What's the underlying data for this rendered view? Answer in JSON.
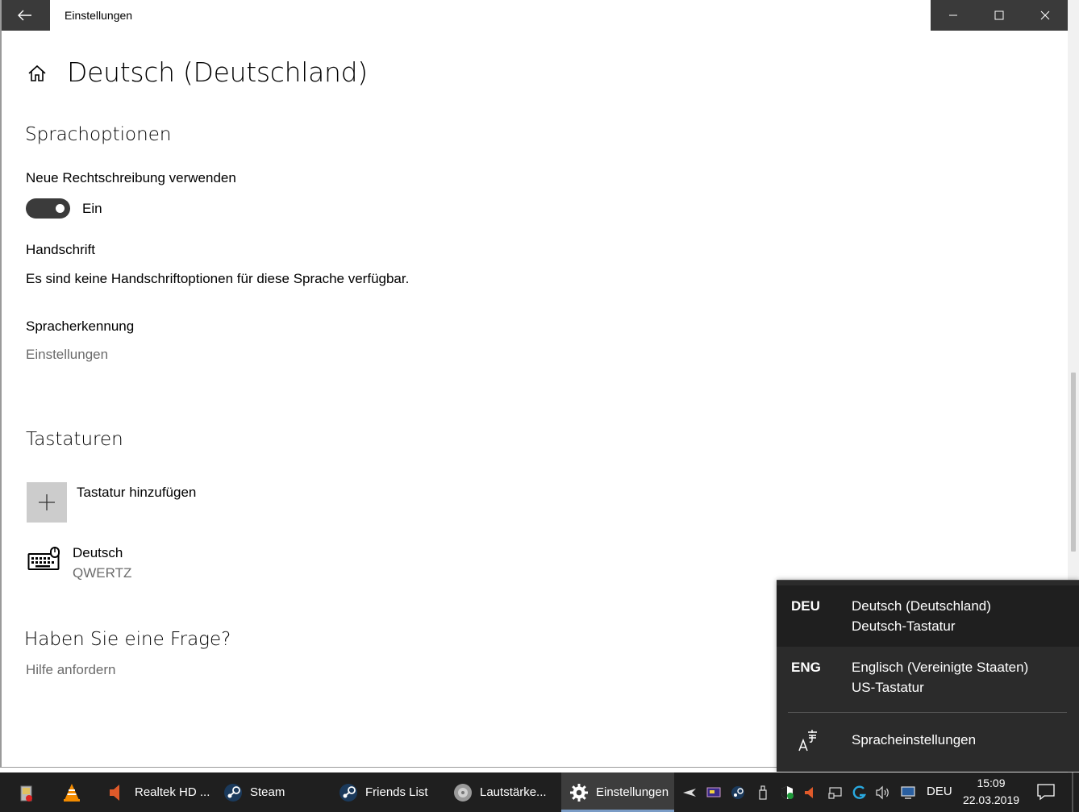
{
  "window": {
    "title": "Einstellungen",
    "back_icon": "arrow-left-icon",
    "controls": [
      "minimize-icon",
      "maximize-icon",
      "close-icon"
    ]
  },
  "page": {
    "home_icon": "home-icon",
    "title": "Deutsch (Deutschland)"
  },
  "sprachoptionen": {
    "heading": "Sprachoptionen",
    "spelling_label": "Neue Rechtschreibung verwenden",
    "spelling_toggle_state": "Ein",
    "handwriting_heading": "Handschrift",
    "handwriting_text": "Es sind keine Handschriftoptionen für diese Sprache verfügbar.",
    "speech_heading": "Spracherkennung",
    "speech_link": "Einstellungen"
  },
  "tastaturen": {
    "heading": "Tastaturen",
    "add_label": "Tastatur hinzufügen",
    "keyboards": [
      {
        "name": "Deutsch",
        "layout": "QWERTZ",
        "icon": "keyboard-icon"
      }
    ]
  },
  "help": {
    "heading": "Haben Sie eine Frage?",
    "link": "Hilfe anfordern"
  },
  "language_flyout": {
    "items": [
      {
        "code": "DEU",
        "language": "Deutsch (Deutschland)",
        "keyboard": "Deutsch-Tastatur",
        "selected": true
      },
      {
        "code": "ENG",
        "language": "Englisch (Vereinigte Staaten)",
        "keyboard": "US-Tastatur",
        "selected": false
      }
    ],
    "settings_label": "Spracheinstellungen",
    "settings_icon": "language-settings-icon"
  },
  "taskbar": {
    "apps": [
      {
        "label": "",
        "icon": "recycle-bin-icon"
      },
      {
        "label": "",
        "icon": "vlc-icon"
      },
      {
        "label": "Realtek HD ...",
        "icon": "speaker-icon"
      },
      {
        "label": "Steam",
        "icon": "steam-icon"
      },
      {
        "label": "Friends List",
        "icon": "steam-icon"
      },
      {
        "label": "Lautstärke...",
        "icon": "volume-mixer-icon"
      },
      {
        "label": "Einstellungen",
        "icon": "gear-icon",
        "active": true
      }
    ],
    "tray_icons": [
      "plane-icon",
      "monitor-app-icon",
      "steam-tray-icon",
      "usb-icon",
      "shield-icon",
      "realtek-tray-icon",
      "display-icon",
      "logitech-icon",
      "volume-icon",
      "network-icon"
    ],
    "language": "DEU",
    "time": "15:09",
    "date": "22.03.2019",
    "active_color": "#7a9cc6"
  }
}
